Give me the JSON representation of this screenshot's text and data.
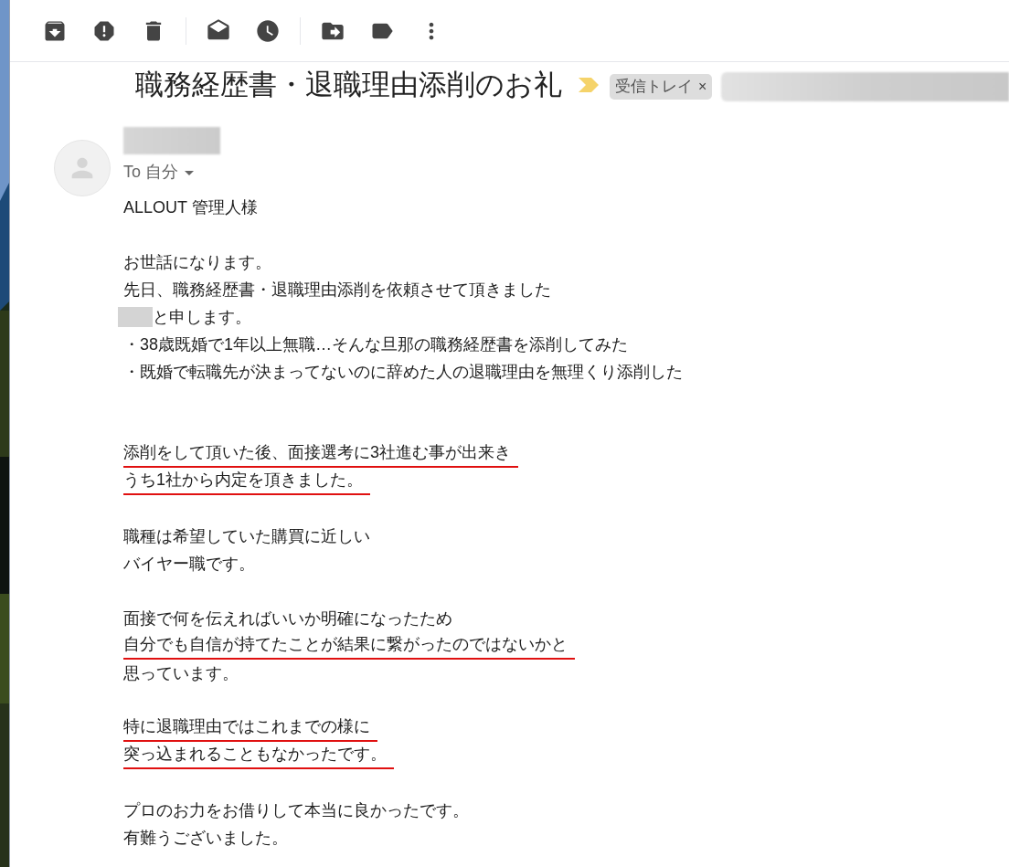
{
  "toolbar": {
    "groups": [
      [
        {
          "kind": "archive"
        },
        {
          "kind": "report"
        },
        {
          "kind": "delete"
        }
      ],
      [
        {
          "kind": "unread"
        },
        {
          "kind": "snooze"
        }
      ],
      [
        {
          "kind": "move"
        },
        {
          "kind": "label"
        },
        {
          "kind": "more"
        }
      ]
    ]
  },
  "subject": "職務経歴書・退職理由添削のお礼",
  "important": true,
  "labels": [
    {
      "text": "受信トレイ",
      "close": "×"
    }
  ],
  "sender": {
    "to": "To 自分"
  },
  "body": [
    {
      "kind": "text",
      "text": "ALLOUT 管理人様",
      "underlined": false,
      "redacted": false
    },
    {
      "kind": "blank"
    },
    {
      "kind": "text",
      "text": "お世話になります。",
      "underlined": false,
      "redacted": false
    },
    {
      "kind": "text",
      "text": "先日、職務経歴書・退職理由添削を依頼させて頂きました",
      "underlined": false,
      "redacted": false
    },
    {
      "kind": "text",
      "text": "と申します。",
      "underlined": false,
      "redacted": true
    },
    {
      "kind": "text",
      "text": "・38歳既婚で1年以上無職…そんな旦那の職務経歴書を添削してみた",
      "underlined": false,
      "redacted": false
    },
    {
      "kind": "text",
      "text": "・既婚で転職先が決まってないのに辞めた人の退職理由を無理くり添削した",
      "underlined": false,
      "redacted": false
    },
    {
      "kind": "blank"
    },
    {
      "kind": "blank"
    },
    {
      "kind": "text",
      "text": "添削をして頂いた後、面接選考に3社進む事が出来き",
      "underlined": true,
      "redacted": false
    },
    {
      "kind": "text",
      "text": "うち1社から内定を頂きました。",
      "underlined": true,
      "redacted": false
    },
    {
      "kind": "blank"
    },
    {
      "kind": "text",
      "text": "職種は希望していた購買に近しい",
      "underlined": false,
      "redacted": false
    },
    {
      "kind": "text",
      "text": "バイヤー職です。",
      "underlined": false,
      "redacted": false
    },
    {
      "kind": "blank"
    },
    {
      "kind": "text",
      "text": "面接で何を伝えればいいか明確になったため",
      "underlined": false,
      "redacted": false
    },
    {
      "kind": "text",
      "text": "自分でも自信が持てたことが結果に繋がったのではないかと",
      "underlined": true,
      "redacted": false
    },
    {
      "kind": "text",
      "text": "思っています。",
      "underlined": false,
      "redacted": false
    },
    {
      "kind": "blank"
    },
    {
      "kind": "text",
      "text": "特に退職理由ではこれまでの様に",
      "underlined": true,
      "redacted": false
    },
    {
      "kind": "text",
      "text": "突っ込まれることもなかったです。",
      "underlined": true,
      "redacted": false
    },
    {
      "kind": "blank"
    },
    {
      "kind": "text",
      "text": "プロのお力をお借りして本当に良かったです。",
      "underlined": false,
      "redacted": false
    },
    {
      "kind": "text",
      "text": "有難うございました。",
      "underlined": false,
      "redacted": false
    }
  ]
}
